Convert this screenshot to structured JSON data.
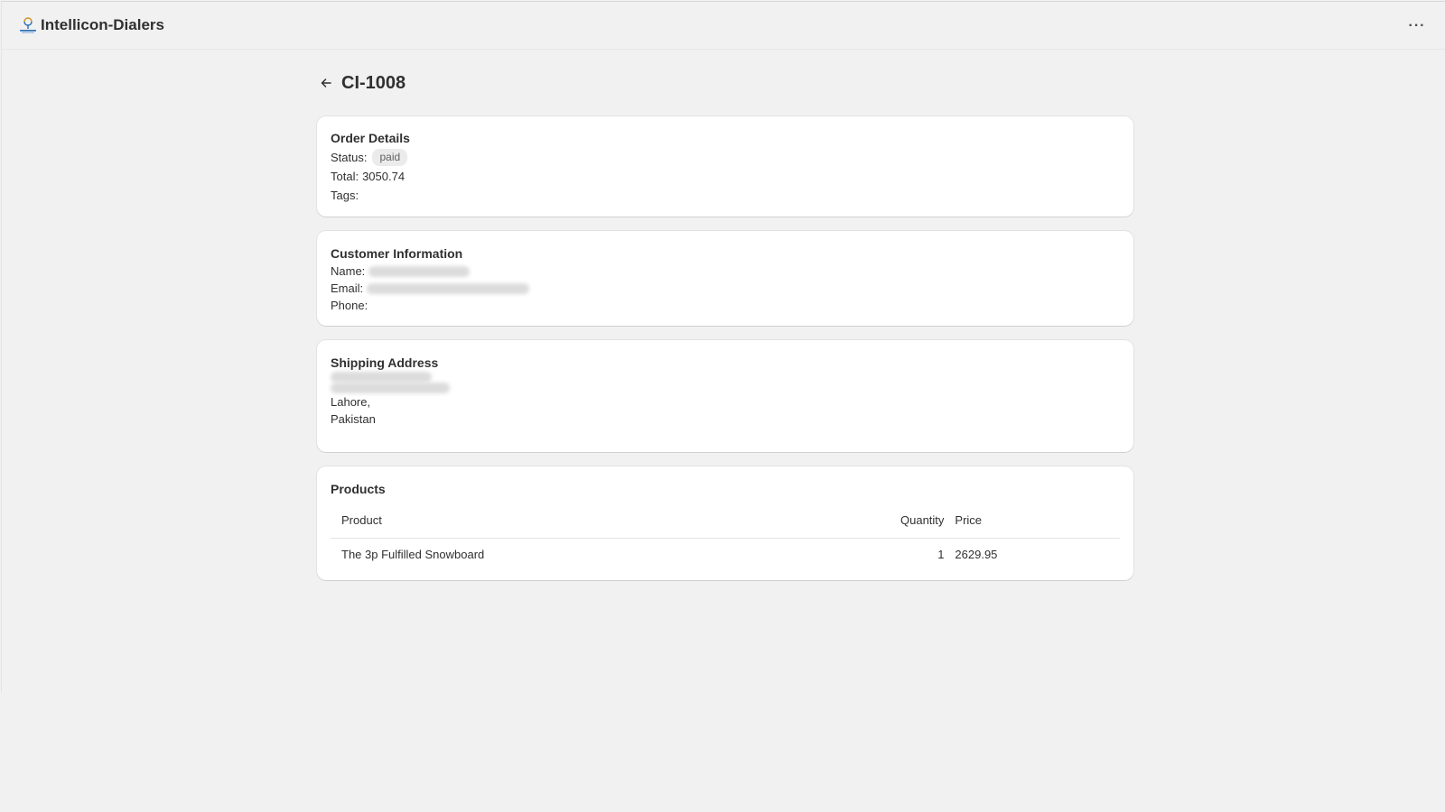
{
  "app": {
    "title": "Intellicon-Dialers",
    "logo_icon": "intellicon-logo-icon",
    "more_icon": "more-horizontal-icon",
    "more_label": "···"
  },
  "page": {
    "title": "CI-1008",
    "back_icon": "arrow-left-icon"
  },
  "order_details": {
    "heading": "Order Details",
    "status_label": "Status:",
    "status_value": "paid",
    "total_label": "Total:",
    "total_value": "3050.74",
    "tags_label": "Tags:",
    "tags_value": ""
  },
  "customer": {
    "heading": "Customer Information",
    "name_label": "Name:",
    "email_label": "Email:",
    "phone_label": "Phone:",
    "phone_value": ""
  },
  "shipping": {
    "heading": "Shipping Address",
    "city_line": "Lahore,",
    "country_line": "Pakistan"
  },
  "products": {
    "heading": "Products",
    "columns": {
      "product": "Product",
      "quantity": "Quantity",
      "price": "Price"
    },
    "rows": [
      {
        "product": "The 3p Fulfilled Snowboard",
        "quantity": "1",
        "price": "2629.95"
      }
    ]
  },
  "colors": {
    "background": "#f1f1f1",
    "card": "#ffffff",
    "text": "#303030",
    "badge_bg": "#ebebeb"
  }
}
